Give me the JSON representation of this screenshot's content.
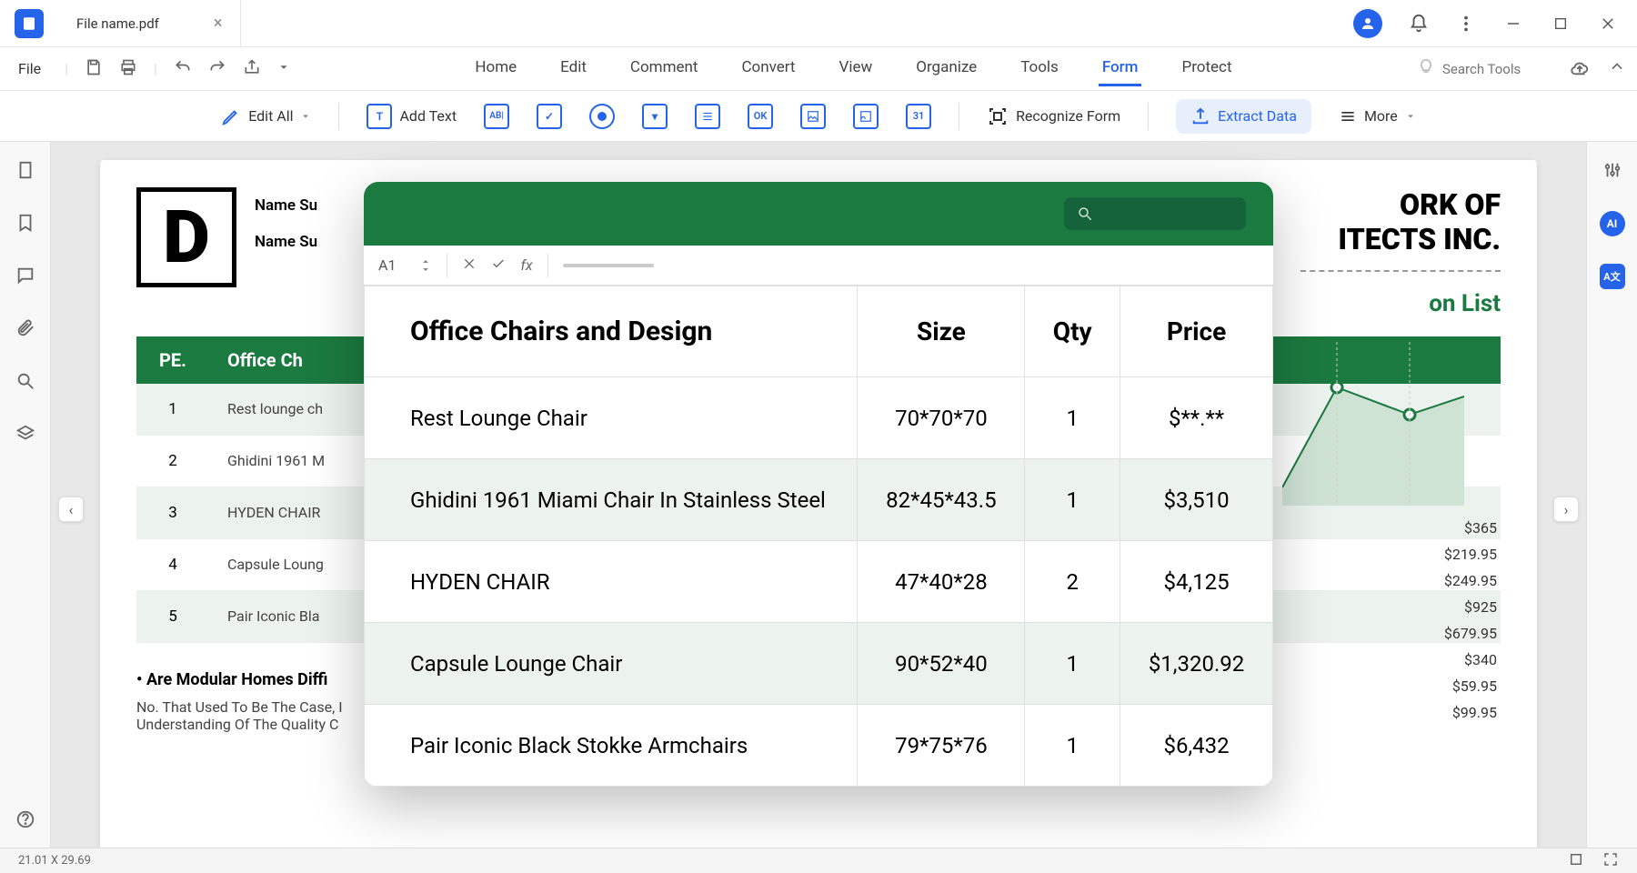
{
  "titlebar": {
    "tab_name": "File name.pdf"
  },
  "menubar": {
    "file": "File",
    "tabs": [
      "Home",
      "Edit",
      "Comment",
      "Convert",
      "View",
      "Organize",
      "Tools",
      "Form",
      "Protect"
    ],
    "active_tab": "Form",
    "search_placeholder": "Search Tools"
  },
  "toolbar": {
    "edit_all": "Edit All",
    "add_text": "Add Text",
    "recognize": "Recognize Form",
    "extract": "Extract Data",
    "more": "More"
  },
  "pdf": {
    "logo_letter": "D",
    "name_label": "Name Su",
    "right_title_1": "ORK OF",
    "right_title_2": "ITECTS INC.",
    "right_subtitle": "on List",
    "table_header_pe": "PE.",
    "table_header_name": "Office Ch",
    "rows": [
      {
        "n": "1",
        "name": "Rest lounge ch"
      },
      {
        "n": "2",
        "name": "Ghidini 1961 M"
      },
      {
        "n": "3",
        "name": "HYDEN CHAIR"
      },
      {
        "n": "4",
        "name": "Capsule Loung"
      },
      {
        "n": "5",
        "name": "Pair Iconic Bla"
      }
    ],
    "question_title": "• Are Modular Homes Diffi",
    "question_body": "No. That Used To Be The Case, I\nUnderstanding Of The Quality C",
    "prices": [
      "$365",
      "$219.95",
      "$249.95",
      "$925",
      "$679.95",
      "$340",
      "$59.95",
      "$99.95"
    ]
  },
  "sheet": {
    "cell_ref": "A1",
    "fx_label": "fx",
    "headers": [
      "Office Chairs and Design",
      "Size",
      "Qty",
      "Price"
    ],
    "rows": [
      {
        "name": "Rest Lounge Chair",
        "size": "70*70*70",
        "qty": "1",
        "price": "$**.**"
      },
      {
        "name": "Ghidini 1961 Miami Chair In Stainless Steel",
        "size": "82*45*43.5",
        "qty": "1",
        "price": "$3,510"
      },
      {
        "name": "HYDEN CHAIR",
        "size": "47*40*28",
        "qty": "2",
        "price": "$4,125"
      },
      {
        "name": "Capsule Lounge Chair",
        "size": "90*52*40",
        "qty": "1",
        "price": "$1,320.92"
      },
      {
        "name": "Pair Iconic Black Stokke Armchairs",
        "size": "79*75*76",
        "qty": "1",
        "price": "$6,432"
      }
    ]
  },
  "status": {
    "dimensions": "21.01 X 29.69"
  }
}
